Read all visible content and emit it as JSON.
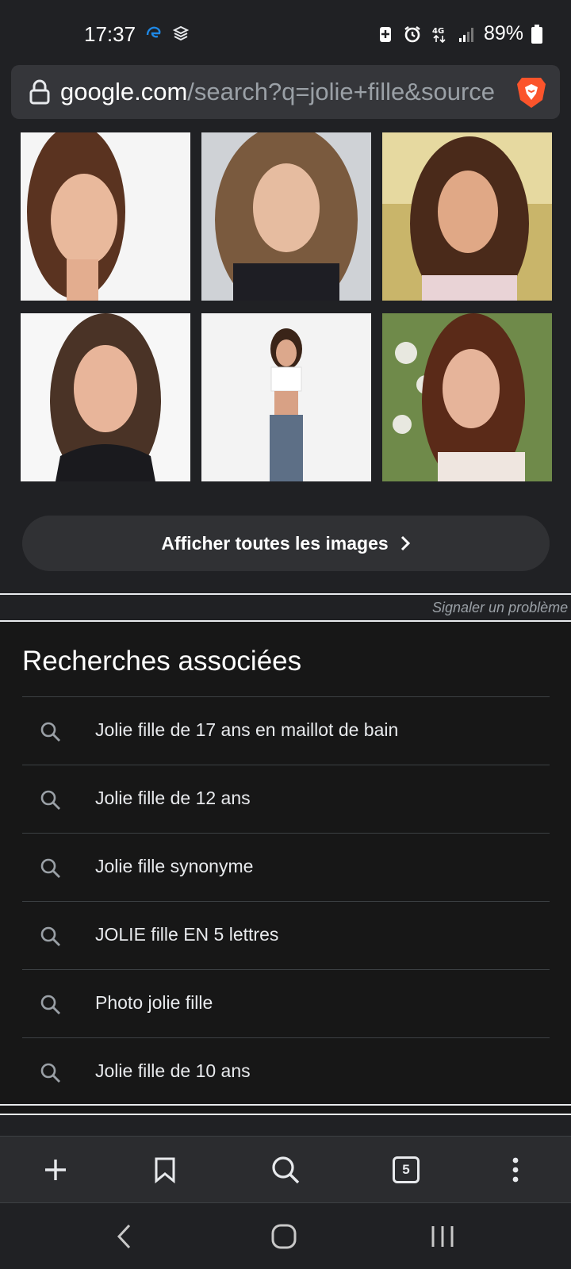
{
  "status": {
    "time": "17:37",
    "battery": "89%",
    "network": "4G",
    "left_icons": [
      "edge-icon",
      "app-stack-icon"
    ],
    "right_icons": [
      "battery-saver-icon",
      "alarm-icon",
      "network-4g-icon",
      "signal-icon",
      "battery-icon"
    ]
  },
  "browser": {
    "url_host": "google.com",
    "url_path": "/search?q=jolie+fille&source",
    "brand_color": "#fb542b"
  },
  "images": {
    "tiles": [
      {
        "name": "image-result-1"
      },
      {
        "name": "image-result-2"
      },
      {
        "name": "image-result-3"
      },
      {
        "name": "image-result-4"
      },
      {
        "name": "image-result-5"
      },
      {
        "name": "image-result-6"
      }
    ],
    "show_all_label": "Afficher toutes les images"
  },
  "report_label": "Signaler un problème",
  "related": {
    "title": "Recherches associées",
    "items": [
      {
        "label": "Jolie fille de 17 ans en maillot de bain"
      },
      {
        "label": "Jolie fille de 12 ans"
      },
      {
        "label": "Jolie fille synonyme"
      },
      {
        "label": "JOLIE fille EN 5 lettres"
      },
      {
        "label": "Photo jolie fille"
      },
      {
        "label": "Jolie fille de 10 ans"
      }
    ]
  },
  "toolbar": {
    "tab_count": "5",
    "buttons": [
      "new-tab",
      "bookmarks",
      "search",
      "tabs",
      "menu"
    ]
  },
  "sysnav": {
    "buttons": [
      "back",
      "home",
      "recents"
    ]
  }
}
